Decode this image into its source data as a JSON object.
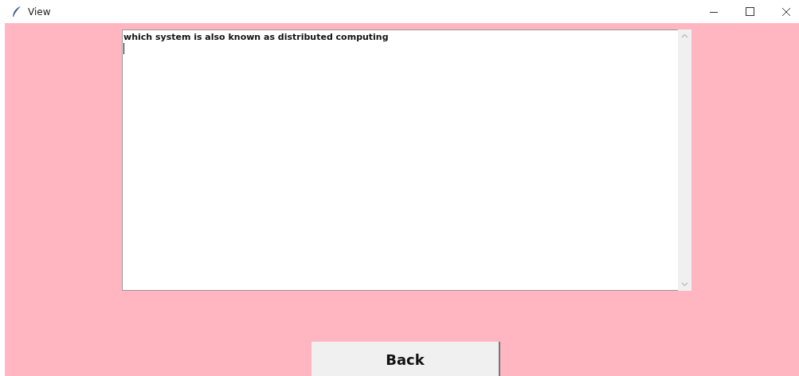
{
  "window": {
    "title": "View"
  },
  "editor": {
    "value": "which system is also known as distributed computing"
  },
  "buttons": [
    {
      "label": "Back"
    }
  ]
}
